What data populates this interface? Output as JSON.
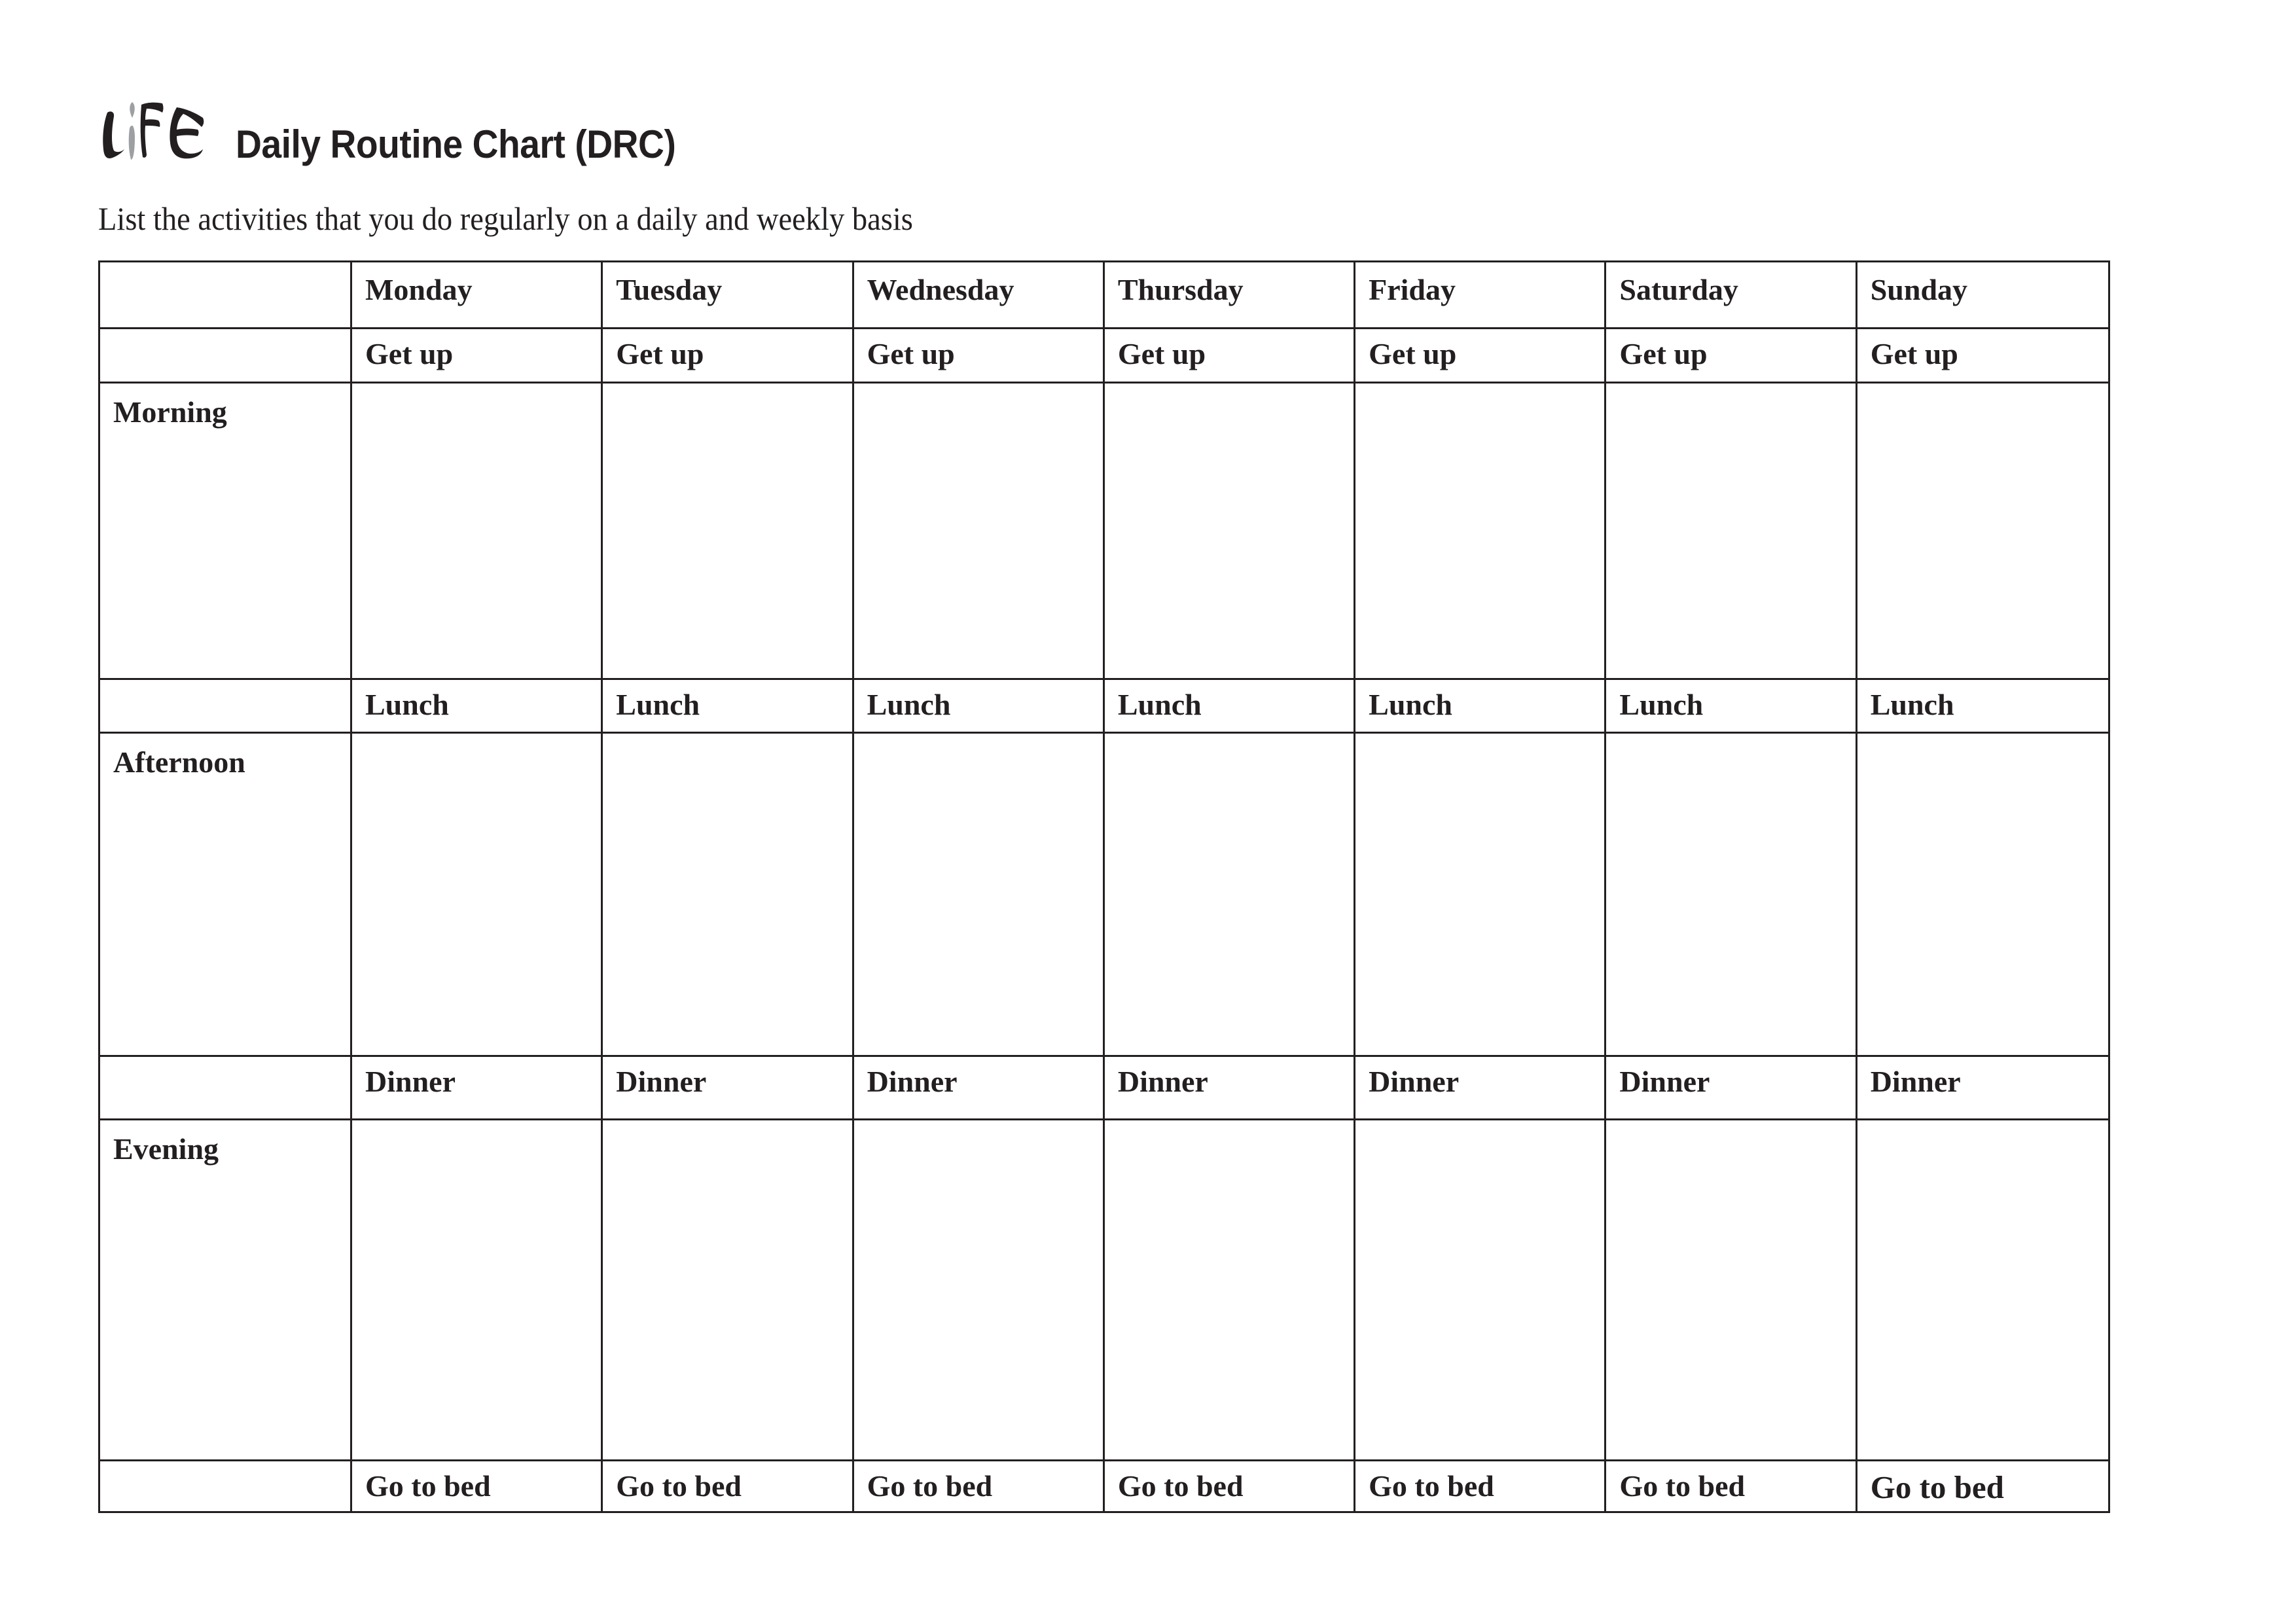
{
  "header": {
    "logo_text": "LIFE",
    "title": "Daily Routine Chart (DRC)",
    "subtitle": "List the activities that you do regularly on a daily and weekly basis",
    "colors": {
      "ink": "#231f20",
      "logo_accent": "#9d9fa2",
      "background": "#ffffff"
    }
  },
  "table": {
    "corner_label": "",
    "days": [
      "Monday",
      "Tuesday",
      "Wednesday",
      "Thursday",
      "Friday",
      "Saturday",
      "Sunday"
    ],
    "rows": [
      {
        "type": "milestone",
        "label": "",
        "cells": [
          "Get up",
          "Get up",
          "Get up",
          "Get up",
          "Get up",
          "Get up",
          "Get up"
        ]
      },
      {
        "type": "period",
        "label": "Morning",
        "cells": [
          "",
          "",
          "",
          "",
          "",
          "",
          ""
        ]
      },
      {
        "type": "milestone",
        "label": "",
        "cells": [
          "Lunch",
          "Lunch",
          "Lunch",
          "Lunch",
          "Lunch",
          "Lunch",
          "Lunch"
        ]
      },
      {
        "type": "period",
        "label": "Afternoon",
        "cells": [
          "",
          "",
          "",
          "",
          "",
          "",
          ""
        ]
      },
      {
        "type": "milestone",
        "label": "",
        "cells": [
          "Dinner",
          "Dinner",
          "Dinner",
          "Dinner",
          "Dinner",
          "Dinner",
          "Dinner"
        ]
      },
      {
        "type": "period",
        "label": "Evening",
        "cells": [
          "",
          "",
          "",
          "",
          "",
          "",
          ""
        ]
      },
      {
        "type": "milestone",
        "label": "",
        "cells": [
          "Go to bed",
          "Go to bed",
          "Go to bed",
          "Go to bed",
          "Go to bed",
          "Go to bed",
          "Go to bed"
        ]
      }
    ]
  }
}
